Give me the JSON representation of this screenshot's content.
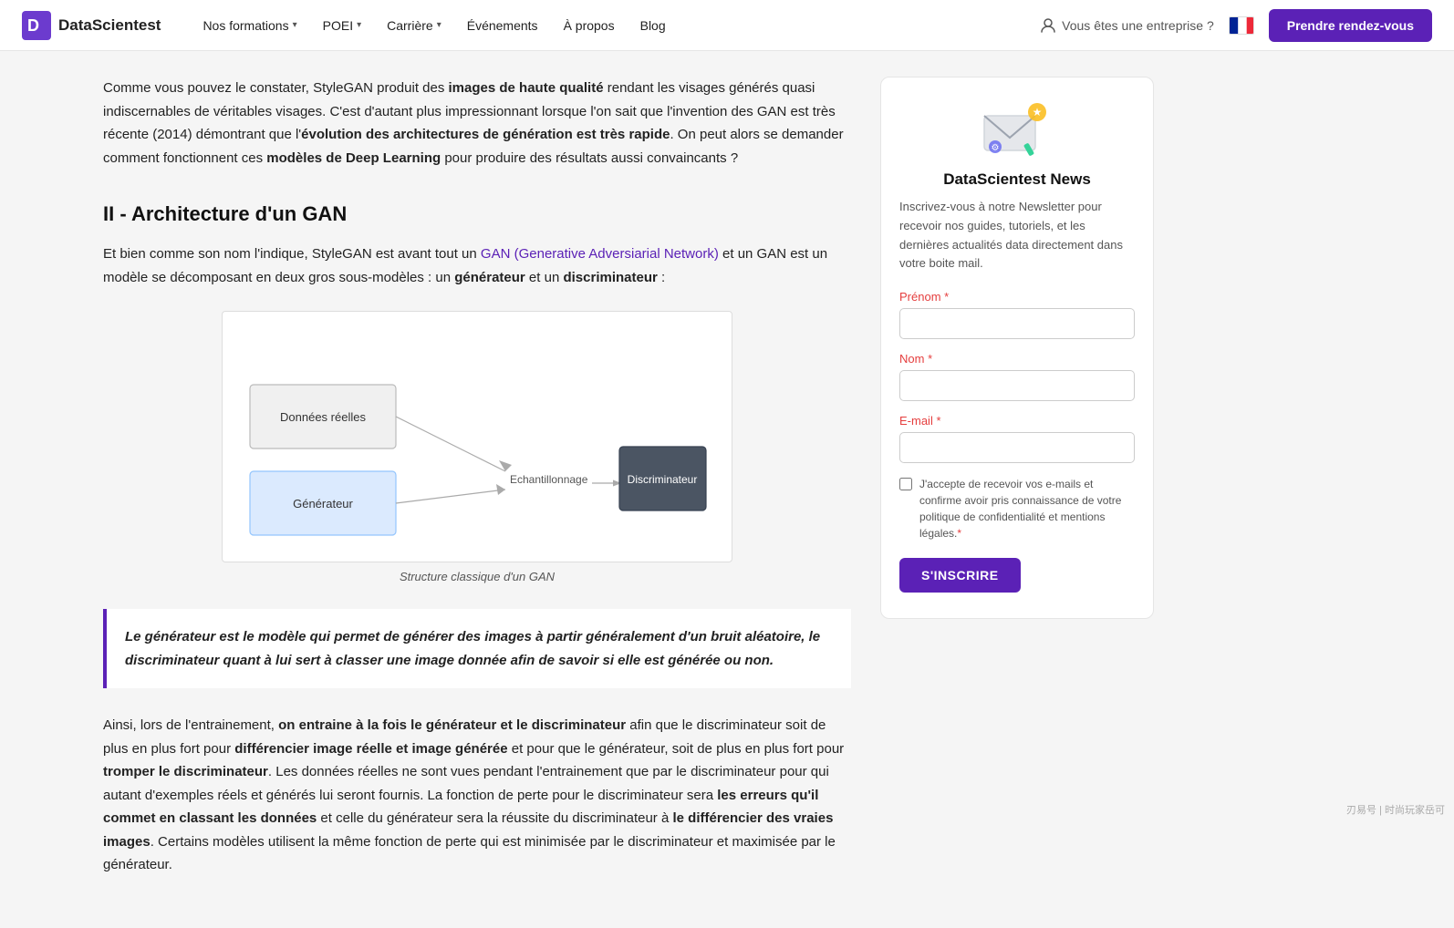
{
  "navbar": {
    "logo_text": "DataScientest",
    "nav_items": [
      {
        "label": "Nos formations",
        "has_dropdown": true
      },
      {
        "label": "POEI",
        "has_dropdown": true
      },
      {
        "label": "Carrière",
        "has_dropdown": true
      },
      {
        "label": "Événements",
        "has_dropdown": false
      },
      {
        "label": "À propos",
        "has_dropdown": false
      },
      {
        "label": "Blog",
        "has_dropdown": false
      }
    ],
    "enterprise_label": "Vous êtes une entreprise ?",
    "cta_label": "Prendre rendez-vous"
  },
  "content": {
    "intro_para": "Comme vous pouvez le constater, StyleGAN produit des images de haute qualité rendant les visages générés quasi indiscernables de véritables visages. C'est d'autant plus impressionnant lorsque l'on sait que l'invention des GAN est très récente (2014) démontrant que l'évolution des architectures de génération est très rapide. On peut alors se demander comment fonctionnent ces modèles de Deep Learning pour produire des résultats aussi convaincants ?",
    "section_title": "II - Architecture d'un GAN",
    "section_para": "Et bien comme son nom l'indique, StyleGAN est avant tout un GAN (Generative Adversiarial Network) et un GAN est un modèle se décomposant en deux gros sous-modèles : un générateur et un discriminateur :",
    "gan_link_text": "GAN (Generative Adversiarial Network)",
    "diagram_caption": "Structure classique d'un GAN",
    "diagram": {
      "node_real": "Données réelles",
      "node_generator": "Générateur",
      "node_sampling": "Echantillonnage",
      "node_discriminator": "Discriminateur"
    },
    "blockquote": "Le générateur est le modèle qui permet de générer des images à partir généralement d'un bruit aléatoire, le discriminateur quant à lui sert à classer une image donnée afin de savoir si elle est générée ou non.",
    "lower_para1_start": "Ainsi, lors de l'entrainement, ",
    "lower_para1_bold1": "on entraine à la fois le générateur et le discriminateur",
    "lower_para1_mid1": " afin que le discriminateur soit de plus en plus fort pour ",
    "lower_para1_bold2": "différencier image réelle et image générée",
    "lower_para1_mid2": " et pour que le générateur, soit de plus en plus fort pour ",
    "lower_para1_bold3": "tromper le discriminateur",
    "lower_para1_end": ". Les données réelles ne sont vues pendant l'entrainement que par le discriminateur pour qui autant d'exemples réels et générés lui seront fournis. La fonction de perte pour le discriminateur sera ",
    "lower_para1_bold4": "les erreurs qu'il commet en classant les données",
    "lower_para1_mid3": " et celle du générateur sera la réussite du discriminateur à ",
    "lower_para1_bold5": "le différencier des vraies images",
    "lower_para1_final": ". Certains modèles utilisent la même fonction de perte qui est minimisée par le discriminateur et maximisée par le générateur."
  },
  "sidebar": {
    "newsletter_title": "DataScientest News",
    "newsletter_desc": "Inscrivez-vous à notre Newsletter pour recevoir nos guides, tutoriels, et les dernières actualités data directement dans votre boite mail.",
    "form": {
      "prenom_label": "Prénom",
      "prenom_required": true,
      "nom_label": "Nom",
      "nom_required": true,
      "email_label": "E-mail",
      "email_required": true,
      "checkbox_text": "J'accepte de recevoir vos e-mails et confirme avoir pris connaissance de votre politique de confidentialité et mentions légales.",
      "subscribe_label": "S'INSCRIRE"
    }
  },
  "watermark": "刃易号 | 时尚玩家岳可"
}
